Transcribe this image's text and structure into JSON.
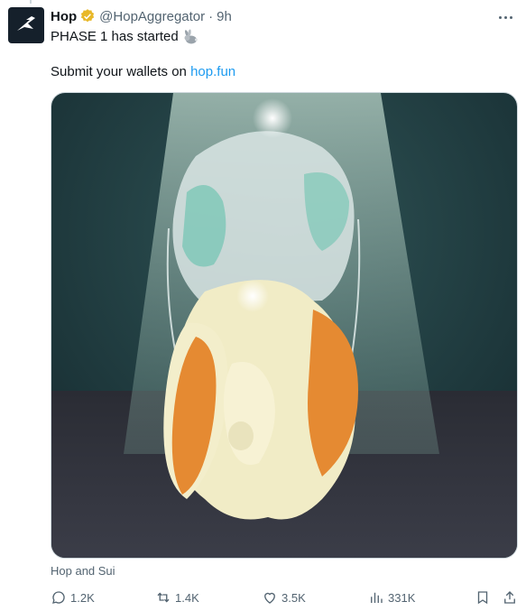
{
  "post": {
    "author_name": "Hop",
    "handle": "@HopAggregator",
    "separator": "·",
    "time": "9h",
    "text_line1": "PHASE 1 has started",
    "text_line2_prefix": "Submit your wallets on ",
    "link_text": "hop.fun",
    "media_caption": "Hop and Sui"
  },
  "actions": {
    "replies": "1.2K",
    "reposts": "1.4K",
    "likes": "3.5K",
    "views": "331K"
  },
  "colors": {
    "link": "#1d9bf0",
    "secondary_text": "#536471",
    "verified": "#e8b829"
  },
  "icons": [
    "avatar-logo",
    "verified-badge-icon",
    "more-options-icon",
    "rabbit-emoji",
    "reply-icon",
    "repost-icon",
    "like-icon",
    "views-icon",
    "bookmark-icon",
    "share-icon"
  ]
}
